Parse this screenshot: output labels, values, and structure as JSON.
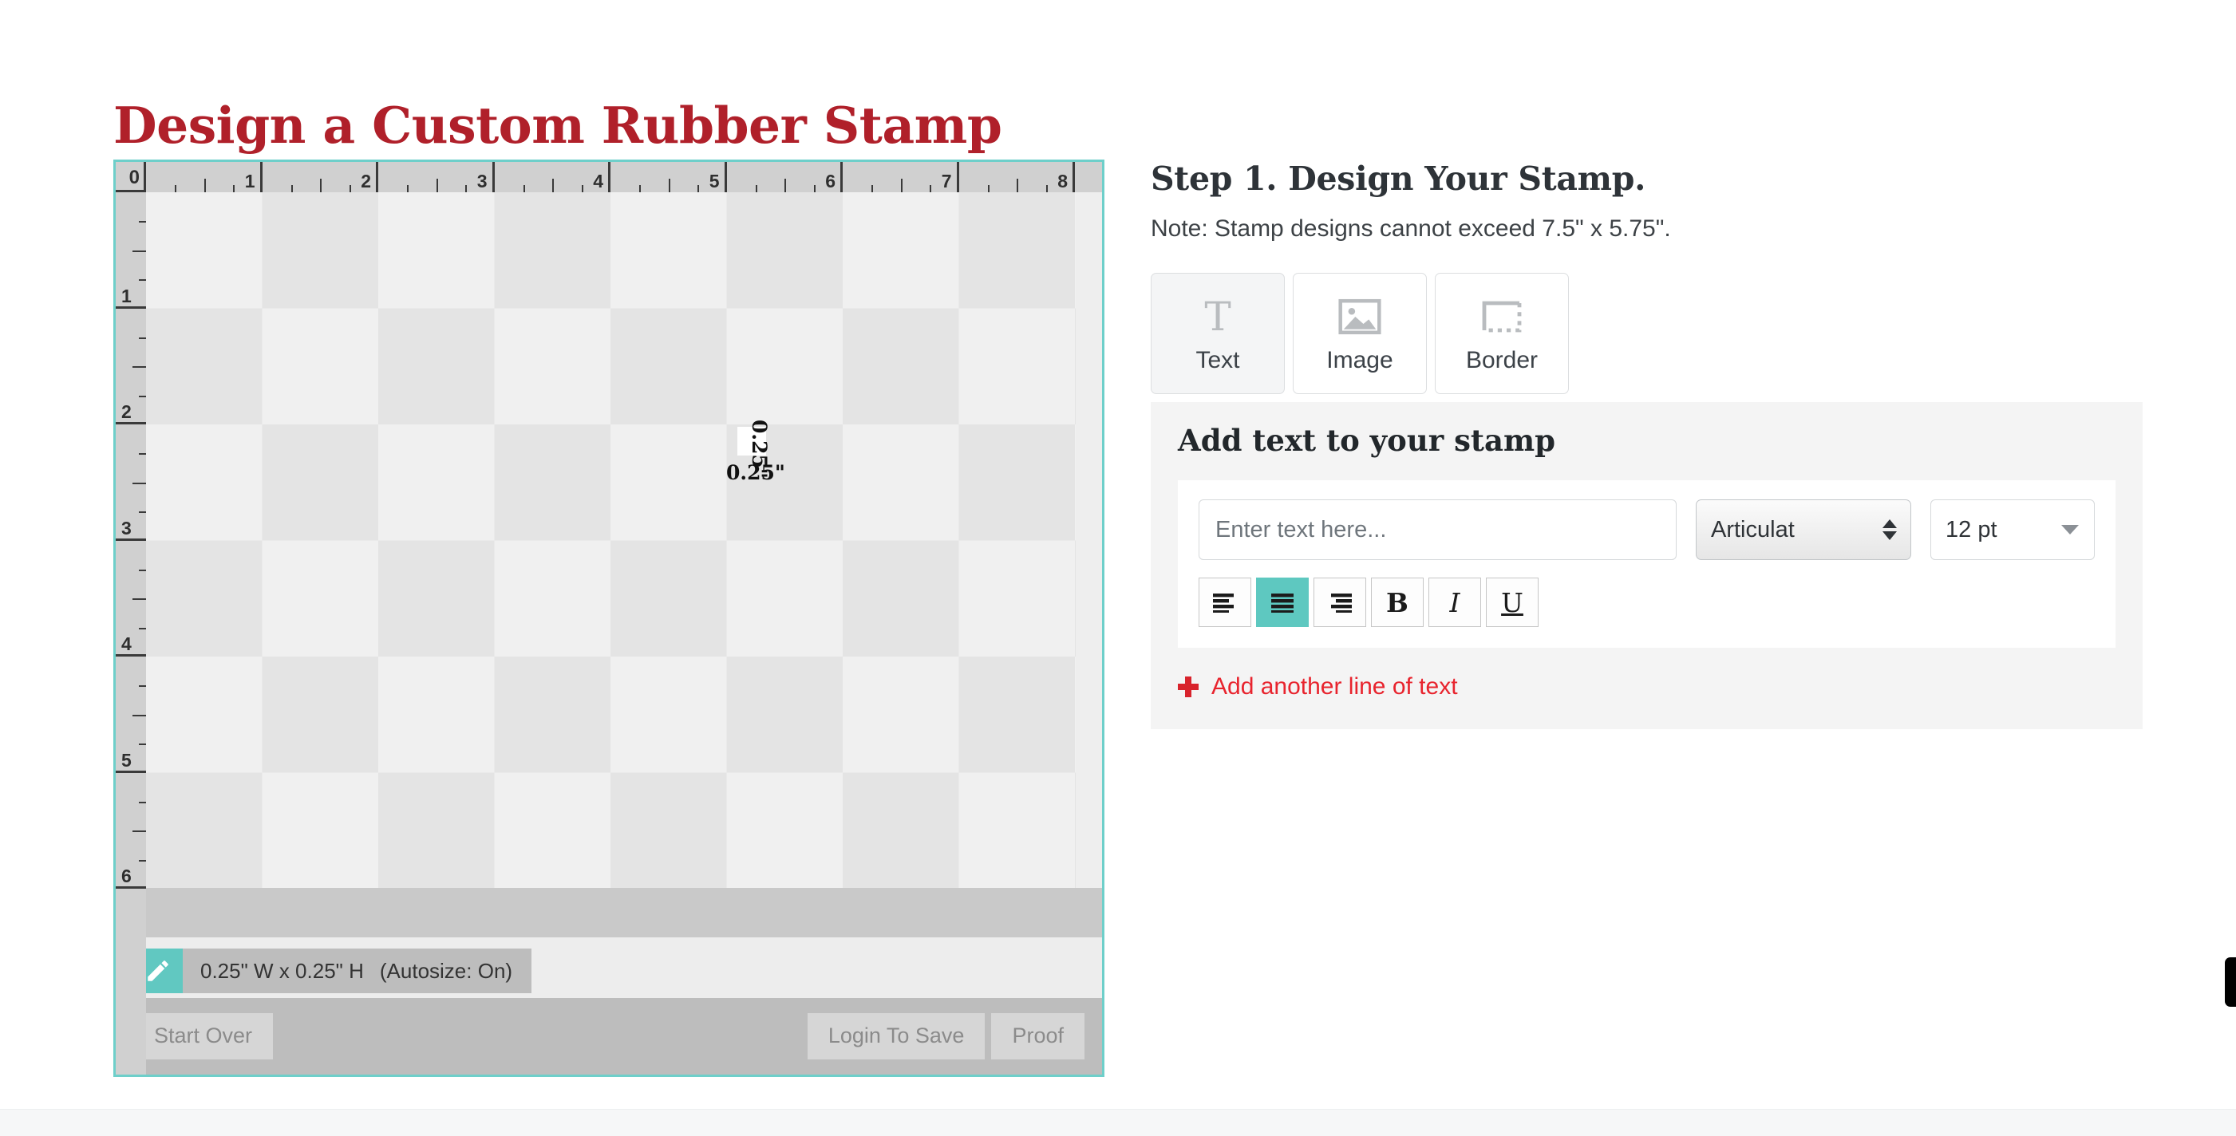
{
  "page": {
    "title": "Design a Custom Rubber Stamp",
    "title_color": "#b0202a"
  },
  "designer": {
    "accent_color": "#6ecfca",
    "ruler": {
      "origin_label": "0",
      "horizontal_labels": [
        "1",
        "2",
        "3",
        "4",
        "5",
        "6",
        "7",
        "8"
      ],
      "vertical_labels": [
        "1",
        "2",
        "3",
        "4",
        "5",
        "6"
      ],
      "unit": "inch"
    },
    "stamp": {
      "width_label": "0.25\"",
      "height_label": "0.25\""
    },
    "size_widget": {
      "icon": "pencil-icon",
      "dimensions_label": "0.25\" W x 0.25\" H",
      "autosize_label": "(Autosize: On)"
    },
    "actions": {
      "start_over": "Start Over",
      "login_to_save": "Login To Save",
      "proof": "Proof"
    }
  },
  "right_panel": {
    "step_title": "Step 1. Design Your Stamp.",
    "note": "Note: Stamp designs cannot exceed 7.5\" x 5.75\".",
    "tabs": [
      {
        "label": "Text",
        "icon": "text-icon",
        "active": true
      },
      {
        "label": "Image",
        "icon": "image-icon",
        "active": false
      },
      {
        "label": "Border",
        "icon": "border-icon",
        "active": false
      }
    ],
    "text_panel": {
      "heading": "Add text to your stamp",
      "text_input": {
        "value": "",
        "placeholder": "Enter text here..."
      },
      "font_select": {
        "value": "Articulat",
        "options": [
          "Articulat"
        ]
      },
      "size_select": {
        "value": "12 pt",
        "options": [
          "12 pt"
        ]
      },
      "format_buttons": [
        {
          "name": "align-left",
          "glyph": "",
          "active": false
        },
        {
          "name": "align-center",
          "glyph": "",
          "active": true
        },
        {
          "name": "align-right",
          "glyph": "",
          "active": false
        },
        {
          "name": "bold",
          "glyph": "B",
          "active": false
        },
        {
          "name": "italic",
          "glyph": "I",
          "active": false
        },
        {
          "name": "underline",
          "glyph": "U",
          "active": false
        }
      ],
      "add_line_label": "Add another line of text",
      "add_line_color": "#e8242e"
    }
  }
}
